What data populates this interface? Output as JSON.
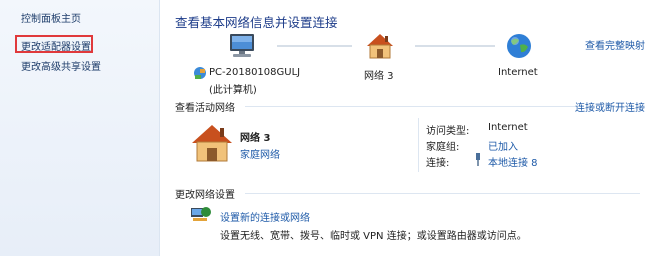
{
  "sidebar": {
    "items": [
      {
        "label": "控制面板主页"
      },
      {
        "label": "更改适配器设置",
        "highlighted": true
      },
      {
        "label": "更改高级共享设置"
      }
    ]
  },
  "header": {
    "title": "查看基本网络信息并设置连接",
    "full_map_link": "查看完整映射"
  },
  "network_map": {
    "pc_name": "PC-20180108GULJ",
    "pc_sub": "(此计算机)",
    "network_name": "网络  3",
    "internet_label": "Internet"
  },
  "active": {
    "section_title": "查看活动网络",
    "connect_link": "连接或断开连接",
    "network_name": "网络  3",
    "network_type": "家庭网络",
    "access_type_label": "访问类型:",
    "access_type_value": "Internet",
    "homegroup_label": "家庭组:",
    "homegroup_value": "已加入",
    "connection_label": "连接:",
    "connection_value": "本地连接 8"
  },
  "change": {
    "section_title": "更改网络设置",
    "new_connection_link": "设置新的连接或网络",
    "new_connection_desc": "设置无线、宽带、拨号、临时或 VPN 连接；或设置路由器或访问点。"
  },
  "colors": {
    "link": "#1e5aa8",
    "title": "#1e3d8a",
    "highlight_border": "#e0393b"
  },
  "icons": [
    "computer-icon",
    "house-icon",
    "globe-icon",
    "network-small-icon",
    "cable-icon",
    "new-connection-icon"
  ]
}
